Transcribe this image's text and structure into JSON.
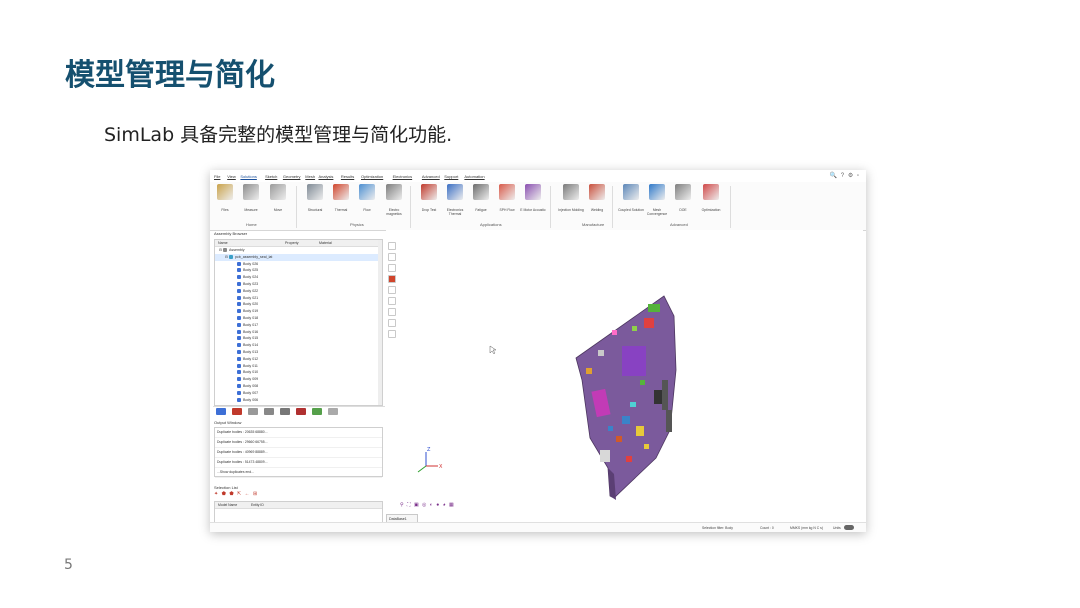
{
  "slide": {
    "title": "模型管理与简化",
    "subtitle": "SimLab 具备完整的模型管理与简化功能.",
    "page_number": "5"
  },
  "app": {
    "menu": [
      "File",
      "View",
      "Solutions",
      "Sketch",
      "Geometry",
      "Mesh",
      "Analysis",
      "Results",
      "Optimization",
      "Electronics",
      "Advanced",
      "Support",
      "Automation"
    ],
    "active_menu": "Solutions",
    "ribbon": {
      "tools": [
        {
          "label": "Files",
          "color": "#c9a24a"
        },
        {
          "label": "Measure",
          "color": "#8c8c8c"
        },
        {
          "label": "Move",
          "color": "#9a9a9a"
        },
        {
          "label": "Structural",
          "color": "#7f8a95"
        },
        {
          "label": "Thermal",
          "color": "#d0452c"
        },
        {
          "label": "Flow",
          "color": "#4d8fd1"
        },
        {
          "label": "Electro magnetics",
          "color": "#7d7d7d"
        },
        {
          "label": "Drop Test",
          "color": "#c0392b"
        },
        {
          "label": "Electronics Thermal",
          "color": "#3b6fc4"
        },
        {
          "label": "Fatigue",
          "color": "#6b6b6b"
        },
        {
          "label": "SPH Flow",
          "color": "#d85a4a"
        },
        {
          "label": "E Motor Acoustic",
          "color": "#8a4fb0"
        },
        {
          "label": "Injection Molding",
          "color": "#7a7a7a"
        },
        {
          "label": "Welding",
          "color": "#c94f3c"
        },
        {
          "label": "Coupled Solution",
          "color": "#5b86b8"
        },
        {
          "label": "Mesh Convergence",
          "color": "#2f79c9"
        },
        {
          "label": "DOE",
          "color": "#7f7f7f"
        },
        {
          "label": "Optimization",
          "color": "#d04848"
        }
      ],
      "groups": [
        "Home",
        "Physics",
        "Applications",
        "Manufacture",
        "Advanced"
      ]
    },
    "assembly_browser": {
      "title": "Assembly Browser",
      "columns": [
        "Name",
        "Property",
        "Material"
      ],
      "root": "Assembly",
      "selected": "pcb_assembly_seal_lat",
      "bodies": [
        "Body 026",
        "Body 025",
        "Body 024",
        "Body 023",
        "Body 022",
        "Body 021",
        "Body 020",
        "Body 019",
        "Body 018",
        "Body 017",
        "Body 016",
        "Body 015",
        "Body 014",
        "Body 013",
        "Body 012",
        "Body 011",
        "Body 010",
        "Body 009",
        "Body 008",
        "Body 007",
        "Body 006"
      ]
    },
    "output_window": {
      "title": "Output Window",
      "lines": [
        "Duplicate bodies : 20635 68880...",
        "Duplicate bodies : 29660 66755...",
        "Duplicate bodies : 40969 88889...",
        "Duplicate bodies : 51473 48809...",
        "...Show duplicates end..."
      ]
    },
    "selection_list": {
      "title": "Selection List",
      "columns": [
        "Model Name",
        "Entity ID"
      ]
    },
    "viewport_tab": "DataBase1",
    "status": {
      "filter": "Selection filter: Body",
      "count": "Count : 0",
      "units": "MMKS (mm kg N C s)",
      "toggle_label": "Units"
    },
    "colors": {
      "board": "#7b5a9c",
      "accent": "#15506f"
    }
  }
}
